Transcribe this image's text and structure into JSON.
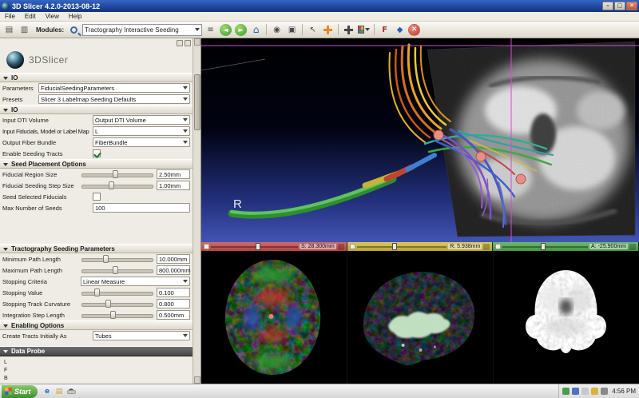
{
  "window": {
    "title": "3D Slicer 4.2.0-2013-08-12"
  },
  "icons": {
    "minimize": "–",
    "maximize": "▢",
    "close": "✕",
    "history": "≡",
    "back": "◄",
    "forward": "►",
    "home": "⌂",
    "screenshot": "◉",
    "scene_view": "▣",
    "pointer": "↖",
    "fiducial": "F",
    "extensions": "◆",
    "close_scene": "✕",
    "load_data": "▤",
    "save_data": "▥",
    "start_flag": "⊞",
    "quick_ie": "e",
    "quick_folder": "▤",
    "quick_slicer": "●"
  },
  "menu": {
    "items": [
      "File",
      "Edit",
      "View",
      "Help"
    ]
  },
  "toolbar": {
    "modules_label": "Modules:",
    "module_value": "Tractography Interactive Seeding"
  },
  "panel": {
    "logo_text": "3DSlicer",
    "section_io_top": "IO",
    "parameters_label": "Parameters",
    "parameters_value": "FiducialSeedingParameters",
    "presets_label": "Presets",
    "presets_value": "Slicer 3 Labelmap Seeding Defaults",
    "section_io": "IO",
    "io": {
      "dti_label": "Input DTI Volume",
      "dti_value": "Output DTI Volume",
      "fiducials_label": "Input Fiducials, Model or Label Map",
      "fiducials_value": "L",
      "bundle_label": "Output Fiber Bundle",
      "bundle_value": "FiberBundle",
      "enable_label": "Enable Seeding Tracts",
      "enable_checked": true
    },
    "section_seed": "Seed Placement Options",
    "seed": {
      "region_label": "Fiducial Region Size",
      "region_value": "2.50mm",
      "step_label": "Fiducial Seeding Step Size",
      "step_value": "1.00mm",
      "selected_label": "Seed Selected Fiducials",
      "selected_checked": false,
      "max_label": "Max Number of Seeds",
      "max_value": "100"
    },
    "section_tracto": "Tractography Seeding Parameters",
    "tracto": {
      "min_label": "Minimum Path Length",
      "min_value": "10.000mm",
      "max_label": "Maximum Path Length",
      "max_value": "800.000mm",
      "criteria_label": "Stopping Criteria",
      "criteria_value": "Linear Measure",
      "stopval_label": "Stopping Value",
      "stopval_value": "0.100",
      "curv_label": "Stopping Track Curvature",
      "curv_value": "0.800",
      "intstep_label": "Integration Step Length",
      "intstep_value": "0.500mm"
    },
    "section_enabling": "Enabling Options",
    "enabling": {
      "tracts_label": "Create Tracts Initially As",
      "tracts_value": "Tubes"
    },
    "section_probe": "Data Probe",
    "probe": {
      "l": "L",
      "f": "F",
      "b": "B"
    }
  },
  "view3d": {
    "orientation_r": "R",
    "crosshair_color": "#d24fd2"
  },
  "slice_bars": {
    "red": {
      "label": "S: 28.300mm",
      "color": "#c35050"
    },
    "yellow": {
      "label": "R: 5.938mm",
      "color": "#cdbb45"
    },
    "green": {
      "label": "A: -25.900mm",
      "color": "#5aa75a"
    }
  },
  "taskbar": {
    "start_label": "Start",
    "clock": "4:56 PM"
  }
}
